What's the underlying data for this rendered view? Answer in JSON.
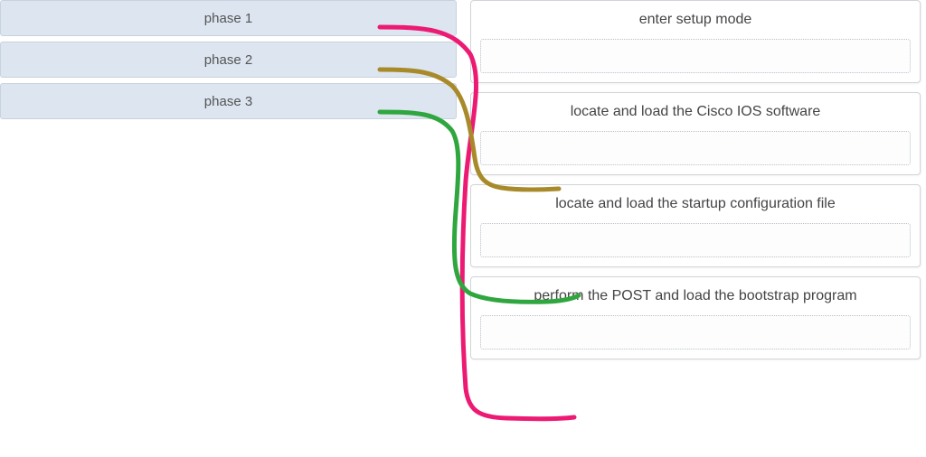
{
  "left": {
    "phases": [
      {
        "label": "phase 1"
      },
      {
        "label": "phase 2"
      },
      {
        "label": "phase 3"
      }
    ]
  },
  "right": {
    "cards": [
      {
        "title": "enter setup mode"
      },
      {
        "title": "locate and load the Cisco IOS software"
      },
      {
        "title": "locate and load the startup configuration file"
      },
      {
        "title": "perform the POST and load the bootstrap program"
      }
    ]
  },
  "connectors": {
    "pink": "#ec1a73",
    "olive": "#a88a2a",
    "green": "#2fa63e"
  }
}
